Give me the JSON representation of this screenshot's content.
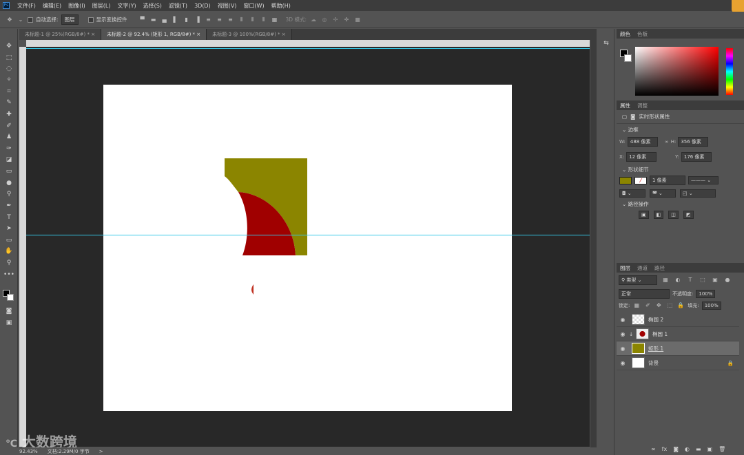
{
  "app": {
    "logo": "Ps",
    "corner_icon": "sync-icon"
  },
  "menu": [
    "文件(F)",
    "编辑(E)",
    "图像(I)",
    "图层(L)",
    "文字(Y)",
    "选择(S)",
    "滤镜(T)",
    "3D(D)",
    "视图(V)",
    "窗口(W)",
    "帮助(H)"
  ],
  "options": {
    "auto_select_label": "自动选择:",
    "auto_select_value": "图层",
    "show_transform_label": "显示变换控件",
    "mode_3d_label": "3D 模式:"
  },
  "tabs": [
    {
      "label": "未标题-1 @ 25%(RGB/8#) *",
      "close": "×"
    },
    {
      "label": "未标题-2 @ 92.4% (矩形 1, RGB/8#) *",
      "close": "×"
    },
    {
      "label": "未标题-3 @ 100%(RGB/8#) *",
      "close": "×"
    }
  ],
  "status": {
    "zoom": "92.43%",
    "doc": "文档:2.29M/0 字节",
    "arrow": ">"
  },
  "watermark": "大数跨境",
  "color_panel": {
    "tabs": [
      "颜色",
      "色板"
    ]
  },
  "properties_panel": {
    "tabs": [
      "属性",
      "调整"
    ],
    "title": "实时形状属性",
    "section_border": "边框",
    "w_label": "W:",
    "w_value": "488 像素",
    "h_label": "H:",
    "h_value": "356 像素",
    "x_label": "X:",
    "x_value": "12 像素",
    "y_label": "Y:",
    "y_value": "176 像素",
    "section_shape": "形状细节",
    "stroke_value": "1 像素",
    "section_path": "路径操作"
  },
  "layers_panel": {
    "tabs": [
      "图层",
      "通道",
      "路径"
    ],
    "filter": "类型",
    "blend": "正常",
    "opacity_label": "不透明度:",
    "opacity_value": "100%",
    "lock_label": "锁定:",
    "fill_label": "填充:",
    "fill_value": "100%",
    "layers": [
      {
        "name": "椭圆 2"
      },
      {
        "name": "椭圆 1"
      },
      {
        "name": "矩形 1"
      },
      {
        "name": "背景"
      }
    ]
  },
  "colors": {
    "olive": "#8b8500",
    "red": "#a00000",
    "guide": "#36c7e6",
    "selected_layer": "#6b6b6b"
  }
}
